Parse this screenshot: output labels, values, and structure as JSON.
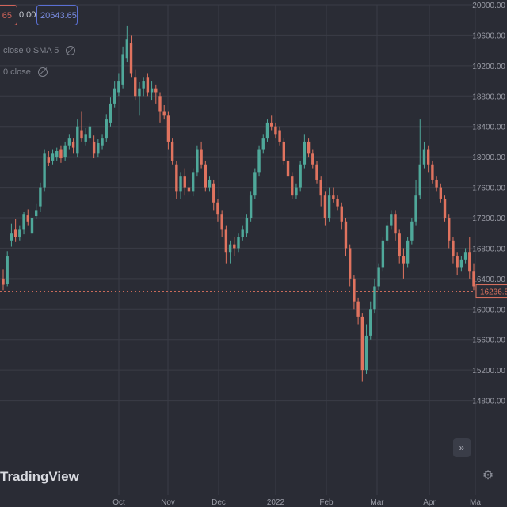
{
  "header": {
    "sell_price": "65",
    "spread": "0.00",
    "buy_price": "20643.65",
    "indicator_1": "close 0 SMA 5",
    "indicator_2": "0 close"
  },
  "branding": {
    "logo": "TradingView"
  },
  "controls": {
    "scroll_icon": "chevrons-right-icon",
    "settings_icon": "gear-icon"
  },
  "colors": {
    "up": "#4fa89a",
    "down": "#e0735f",
    "background": "#2a2c35",
    "grid": "#3a3c46",
    "price_tag": "#e0735f"
  },
  "chart_data": {
    "type": "candlestick",
    "title": "",
    "ylim": [
      14400,
      20000
    ],
    "y_ticks": [
      "20000.00",
      "19600.00",
      "19200.00",
      "18800.00",
      "18400.00",
      "18000.00",
      "17600.00",
      "17200.00",
      "16800.00",
      "16400.00",
      "16000.00",
      "15600.00",
      "15200.00",
      "14800.00"
    ],
    "x_ticks": [
      "Oct",
      "Nov",
      "Dec",
      "2022",
      "Feb",
      "Mar",
      "Apr",
      "Ma"
    ],
    "last_price": "16236.5",
    "grid": true,
    "candles": [
      [
        16400,
        16320,
        16520,
        16250
      ],
      [
        16330,
        16700,
        16760,
        16300
      ],
      [
        16900,
        17000,
        17120,
        16820
      ],
      [
        17050,
        16950,
        17180,
        16890
      ],
      [
        16950,
        17050,
        17100,
        16900
      ],
      [
        17050,
        17250,
        17280,
        16980
      ],
      [
        17230,
        17150,
        17310,
        17100
      ],
      [
        17000,
        17200,
        17260,
        16950
      ],
      [
        17220,
        17300,
        17390,
        17180
      ],
      [
        17350,
        17600,
        17660,
        17280
      ],
      [
        17600,
        18050,
        18100,
        17550
      ],
      [
        18000,
        17920,
        18080,
        17880
      ],
      [
        17950,
        18050,
        18100,
        17900
      ],
      [
        18000,
        18080,
        18120,
        17950
      ],
      [
        18100,
        17980,
        18150,
        17920
      ],
      [
        18000,
        18150,
        18200,
        17950
      ],
      [
        18150,
        18250,
        18300,
        18100
      ],
      [
        18200,
        18120,
        18250,
        18050
      ],
      [
        18050,
        18400,
        18500,
        18000
      ],
      [
        18350,
        18250,
        18600,
        18200
      ],
      [
        18200,
        18300,
        18380,
        18150
      ],
      [
        18250,
        18400,
        18450,
        18200
      ],
      [
        18200,
        18050,
        18280,
        17980
      ],
      [
        18050,
        18180,
        18230,
        18000
      ],
      [
        18150,
        18250,
        18300,
        18100
      ],
      [
        18250,
        18500,
        18560,
        18200
      ],
      [
        18450,
        18700,
        18780,
        18400
      ],
      [
        18700,
        18900,
        19000,
        18650
      ],
      [
        18850,
        19000,
        19100,
        18800
      ],
      [
        18950,
        19350,
        19450,
        18900
      ],
      [
        19300,
        19550,
        19720,
        19250
      ],
      [
        19500,
        19100,
        19600,
        19050
      ],
      [
        19050,
        18800,
        19150,
        18750
      ],
      [
        18800,
        18900,
        18980,
        18550
      ],
      [
        18900,
        19000,
        19050,
        18800
      ],
      [
        19050,
        18850,
        19100,
        18800
      ],
      [
        18850,
        18900,
        19000,
        18750
      ],
      [
        18900,
        18850,
        18950,
        18700
      ],
      [
        18800,
        18600,
        18850,
        18450
      ],
      [
        18600,
        18550,
        18680,
        18500
      ],
      [
        18550,
        18200,
        18600,
        18100
      ],
      [
        18200,
        17950,
        18250,
        17900
      ],
      [
        17900,
        17550,
        17950,
        17450
      ],
      [
        17550,
        17750,
        17800,
        17450
      ],
      [
        17750,
        17600,
        17850,
        17500
      ],
      [
        17600,
        17550,
        17700,
        17500
      ],
      [
        17550,
        17800,
        17850,
        17480
      ],
      [
        17800,
        18100,
        18150,
        17750
      ],
      [
        18100,
        17900,
        18200,
        17850
      ],
      [
        17900,
        17600,
        17950,
        17550
      ],
      [
        17600,
        17700,
        17750,
        17550
      ],
      [
        17650,
        17400,
        17700,
        17300
      ],
      [
        17400,
        17250,
        17450,
        17150
      ],
      [
        17250,
        17050,
        17300,
        16950
      ],
      [
        17050,
        16750,
        17100,
        16600
      ],
      [
        16750,
        16850,
        16900,
        16600
      ],
      [
        16850,
        16800,
        16950,
        16700
      ],
      [
        16800,
        16950,
        17000,
        16750
      ],
      [
        16950,
        17050,
        17100,
        16900
      ],
      [
        17000,
        17200,
        17250,
        16950
      ],
      [
        17200,
        17500,
        17550,
        17150
      ],
      [
        17500,
        17800,
        17850,
        17450
      ],
      [
        17800,
        18100,
        18150,
        17750
      ],
      [
        18100,
        18250,
        18300,
        18050
      ],
      [
        18250,
        18450,
        18500,
        18200
      ],
      [
        18450,
        18400,
        18550,
        18350
      ],
      [
        18400,
        18300,
        18450,
        18250
      ],
      [
        18350,
        18200,
        18400,
        18150
      ],
      [
        18200,
        17950,
        18250,
        17900
      ],
      [
        17950,
        17750,
        18000,
        17700
      ],
      [
        17750,
        17500,
        17800,
        17450
      ],
      [
        17500,
        17600,
        17650,
        17450
      ],
      [
        17600,
        17900,
        17950,
        17550
      ],
      [
        17900,
        18200,
        18300,
        17850
      ],
      [
        18200,
        18050,
        18250,
        18000
      ],
      [
        18050,
        17900,
        18100,
        17850
      ],
      [
        17900,
        17700,
        17950,
        17650
      ],
      [
        17700,
        17500,
        17750,
        17350
      ],
      [
        17500,
        17200,
        17550,
        17100
      ],
      [
        17200,
        17500,
        17600,
        17150
      ],
      [
        17500,
        17450,
        17600,
        17400
      ],
      [
        17450,
        17350,
        17500,
        17300
      ],
      [
        17350,
        17150,
        17400,
        17050
      ],
      [
        17150,
        16800,
        17200,
        16700
      ],
      [
        16800,
        16400,
        16850,
        16300
      ],
      [
        16400,
        16100,
        16450,
        16000
      ],
      [
        16100,
        15900,
        16150,
        15800
      ],
      [
        15900,
        15200,
        15950,
        15050
      ],
      [
        15200,
        15650,
        15800,
        15150
      ],
      [
        15650,
        16000,
        16100,
        15600
      ],
      [
        16000,
        16300,
        16400,
        15950
      ],
      [
        16300,
        16550,
        16600,
        16250
      ],
      [
        16550,
        16900,
        16950,
        16500
      ],
      [
        16900,
        17100,
        17150,
        16850
      ],
      [
        17100,
        17250,
        17300,
        17050
      ],
      [
        17250,
        17000,
        17300,
        16900
      ],
      [
        17000,
        16700,
        17050,
        16600
      ],
      [
        16700,
        16600,
        16800,
        16400
      ],
      [
        16600,
        16900,
        16950,
        16550
      ],
      [
        16900,
        17150,
        17200,
        16850
      ],
      [
        17150,
        17500,
        17700,
        17100
      ],
      [
        17500,
        17900,
        18500,
        17450
      ],
      [
        17900,
        18100,
        18200,
        17850
      ],
      [
        18100,
        17900,
        18150,
        17800
      ],
      [
        17900,
        17700,
        17950,
        17650
      ],
      [
        17700,
        17600,
        17750,
        17550
      ],
      [
        17600,
        17450,
        17650,
        17400
      ],
      [
        17450,
        17200,
        17500,
        17150
      ],
      [
        17200,
        16900,
        17250,
        16800
      ],
      [
        16900,
        16700,
        16950,
        16600
      ],
      [
        16700,
        16550,
        16750,
        16450
      ],
      [
        16550,
        16650,
        16700,
        16500
      ],
      [
        16650,
        16750,
        16800,
        16600
      ],
      [
        16750,
        16500,
        16950,
        16400
      ],
      [
        16500,
        16300,
        16600,
        16250
      ]
    ]
  }
}
